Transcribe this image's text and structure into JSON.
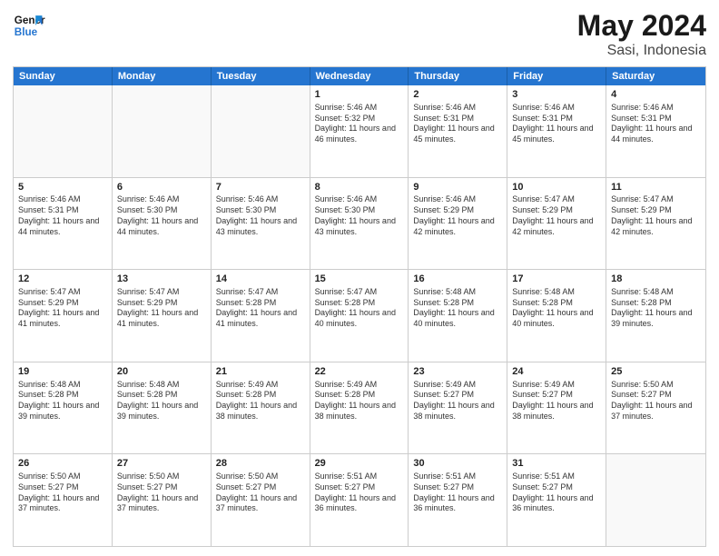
{
  "header": {
    "logo_line1": "General",
    "logo_line2": "Blue",
    "month_year": "May 2024",
    "location": "Sasi, Indonesia"
  },
  "days": [
    "Sunday",
    "Monday",
    "Tuesday",
    "Wednesday",
    "Thursday",
    "Friday",
    "Saturday"
  ],
  "rows": [
    [
      {
        "day": "",
        "content": ""
      },
      {
        "day": "",
        "content": ""
      },
      {
        "day": "",
        "content": ""
      },
      {
        "day": "1",
        "content": "Sunrise: 5:46 AM\nSunset: 5:32 PM\nDaylight: 11 hours and 46 minutes."
      },
      {
        "day": "2",
        "content": "Sunrise: 5:46 AM\nSunset: 5:31 PM\nDaylight: 11 hours and 45 minutes."
      },
      {
        "day": "3",
        "content": "Sunrise: 5:46 AM\nSunset: 5:31 PM\nDaylight: 11 hours and 45 minutes."
      },
      {
        "day": "4",
        "content": "Sunrise: 5:46 AM\nSunset: 5:31 PM\nDaylight: 11 hours and 44 minutes."
      }
    ],
    [
      {
        "day": "5",
        "content": "Sunrise: 5:46 AM\nSunset: 5:31 PM\nDaylight: 11 hours and 44 minutes."
      },
      {
        "day": "6",
        "content": "Sunrise: 5:46 AM\nSunset: 5:30 PM\nDaylight: 11 hours and 44 minutes."
      },
      {
        "day": "7",
        "content": "Sunrise: 5:46 AM\nSunset: 5:30 PM\nDaylight: 11 hours and 43 minutes."
      },
      {
        "day": "8",
        "content": "Sunrise: 5:46 AM\nSunset: 5:30 PM\nDaylight: 11 hours and 43 minutes."
      },
      {
        "day": "9",
        "content": "Sunrise: 5:46 AM\nSunset: 5:29 PM\nDaylight: 11 hours and 42 minutes."
      },
      {
        "day": "10",
        "content": "Sunrise: 5:47 AM\nSunset: 5:29 PM\nDaylight: 11 hours and 42 minutes."
      },
      {
        "day": "11",
        "content": "Sunrise: 5:47 AM\nSunset: 5:29 PM\nDaylight: 11 hours and 42 minutes."
      }
    ],
    [
      {
        "day": "12",
        "content": "Sunrise: 5:47 AM\nSunset: 5:29 PM\nDaylight: 11 hours and 41 minutes."
      },
      {
        "day": "13",
        "content": "Sunrise: 5:47 AM\nSunset: 5:29 PM\nDaylight: 11 hours and 41 minutes."
      },
      {
        "day": "14",
        "content": "Sunrise: 5:47 AM\nSunset: 5:28 PM\nDaylight: 11 hours and 41 minutes."
      },
      {
        "day": "15",
        "content": "Sunrise: 5:47 AM\nSunset: 5:28 PM\nDaylight: 11 hours and 40 minutes."
      },
      {
        "day": "16",
        "content": "Sunrise: 5:48 AM\nSunset: 5:28 PM\nDaylight: 11 hours and 40 minutes."
      },
      {
        "day": "17",
        "content": "Sunrise: 5:48 AM\nSunset: 5:28 PM\nDaylight: 11 hours and 40 minutes."
      },
      {
        "day": "18",
        "content": "Sunrise: 5:48 AM\nSunset: 5:28 PM\nDaylight: 11 hours and 39 minutes."
      }
    ],
    [
      {
        "day": "19",
        "content": "Sunrise: 5:48 AM\nSunset: 5:28 PM\nDaylight: 11 hours and 39 minutes."
      },
      {
        "day": "20",
        "content": "Sunrise: 5:48 AM\nSunset: 5:28 PM\nDaylight: 11 hours and 39 minutes."
      },
      {
        "day": "21",
        "content": "Sunrise: 5:49 AM\nSunset: 5:28 PM\nDaylight: 11 hours and 38 minutes."
      },
      {
        "day": "22",
        "content": "Sunrise: 5:49 AM\nSunset: 5:28 PM\nDaylight: 11 hours and 38 minutes."
      },
      {
        "day": "23",
        "content": "Sunrise: 5:49 AM\nSunset: 5:27 PM\nDaylight: 11 hours and 38 minutes."
      },
      {
        "day": "24",
        "content": "Sunrise: 5:49 AM\nSunset: 5:27 PM\nDaylight: 11 hours and 38 minutes."
      },
      {
        "day": "25",
        "content": "Sunrise: 5:50 AM\nSunset: 5:27 PM\nDaylight: 11 hours and 37 minutes."
      }
    ],
    [
      {
        "day": "26",
        "content": "Sunrise: 5:50 AM\nSunset: 5:27 PM\nDaylight: 11 hours and 37 minutes."
      },
      {
        "day": "27",
        "content": "Sunrise: 5:50 AM\nSunset: 5:27 PM\nDaylight: 11 hours and 37 minutes."
      },
      {
        "day": "28",
        "content": "Sunrise: 5:50 AM\nSunset: 5:27 PM\nDaylight: 11 hours and 37 minutes."
      },
      {
        "day": "29",
        "content": "Sunrise: 5:51 AM\nSunset: 5:27 PM\nDaylight: 11 hours and 36 minutes."
      },
      {
        "day": "30",
        "content": "Sunrise: 5:51 AM\nSunset: 5:27 PM\nDaylight: 11 hours and 36 minutes."
      },
      {
        "day": "31",
        "content": "Sunrise: 5:51 AM\nSunset: 5:27 PM\nDaylight: 11 hours and 36 minutes."
      },
      {
        "day": "",
        "content": ""
      }
    ]
  ]
}
